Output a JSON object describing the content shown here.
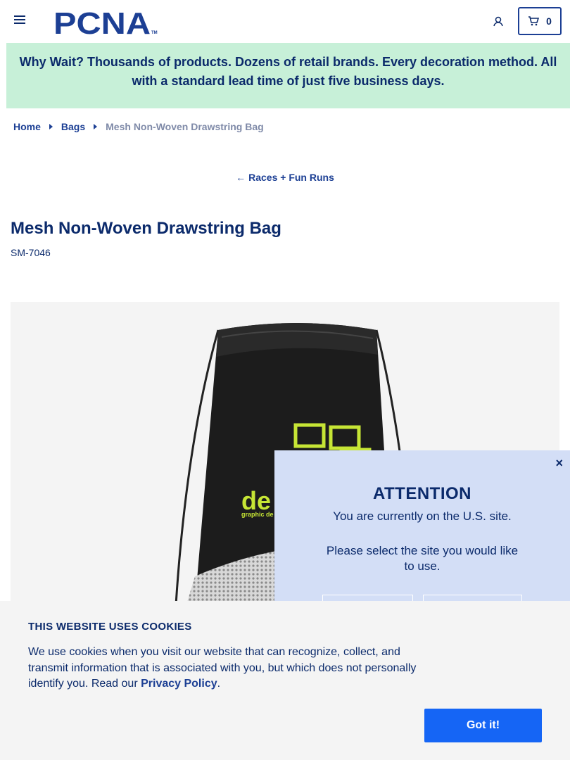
{
  "header": {
    "logo_text": "PCNA",
    "logo_tm": "TM",
    "cart_count": "0"
  },
  "banner": {
    "text": "Why Wait? Thousands of products. Dozens of retail brands. Every decoration method. All with a standard lead time of just five business days."
  },
  "breadcrumb": {
    "home": "Home",
    "category": "Bags",
    "current": "Mesh Non-Woven Drawstring Bag"
  },
  "back_link": {
    "arrow": "←",
    "label": "Races + Fun Runs"
  },
  "product": {
    "title": "Mesh Non-Woven Drawstring Bag",
    "sku": "SM-7046",
    "imprint_text": "de",
    "imprint_subtext": "graphic de"
  },
  "attention": {
    "close": "×",
    "title": "ATTENTION",
    "line1": "You are currently on the U.S. site.",
    "line2": "Please select the site you would like to use."
  },
  "cookie": {
    "title": "THIS WEBSITE USES COOKIES",
    "text": "We use cookies when you visit our website that can recognize, collect, and transmit information that is associated with you, but which does not personally identify you. Read our ",
    "link": "Privacy Policy",
    "period": ".",
    "button": "Got it!"
  },
  "colors": {
    "navy": "#0b2a6b",
    "banner_bg": "#c7f0d8",
    "modal_bg": "#d3def6",
    "accent_blue": "#1565f5",
    "imprint_green": "#c6e535"
  }
}
